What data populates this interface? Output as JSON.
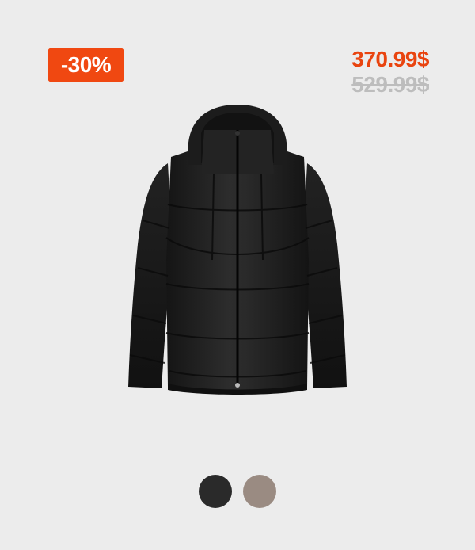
{
  "badge": {
    "discount_label": "-30%"
  },
  "price": {
    "current": "370.99$",
    "old": "529.99$"
  },
  "product": {
    "image_icon": "puffer-jacket-image"
  },
  "swatches": [
    {
      "name": "black",
      "color": "#2a2a2a"
    },
    {
      "name": "taupe",
      "color": "#9a8b82"
    }
  ],
  "colors": {
    "accent": "#f04811",
    "background": "#ececec",
    "old_price": "#bdbdbd"
  }
}
